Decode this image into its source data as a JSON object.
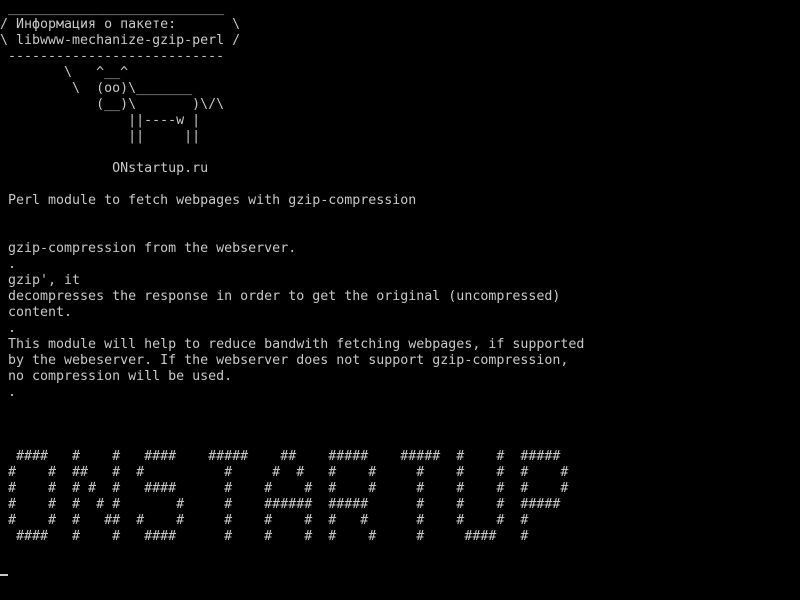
{
  "colors": {
    "background": "#000000",
    "foreground": "#c8c8c8"
  },
  "terminal": {
    "lines": [
      " ___________________________",
      "/ Информация о пакете:       \\",
      "\\ libwww-mechanize-gzip-perl /",
      " ---------------------------",
      "        \\   ^__^",
      "         \\  (oo)\\_______",
      "            (__)\\       )\\/\\",
      "                ||----w |",
      "                ||     ||",
      "",
      "              ONstartup.ru",
      "",
      " Perl module to fetch webpages with gzip-compression",
      "",
      "",
      " gzip-compression from the webserver.",
      " .",
      " gzip', it",
      " decompresses the response in order to get the original (uncompressed)",
      " content.",
      " .",
      " This module will help to reduce bandwith fetching webpages, if supported",
      " by the webeserver. If the webserver does not support gzip-compression,",
      " no compression will be used.",
      " .",
      "",
      "",
      "",
      "  ####   #    #   ####    #####    ##    #####    #####  #    #  #####",
      " #    #  ##   #  #          #     #  #   #    #     #    #    #  #    #",
      " #    #  # #  #   ####      #    #    #  #    #     #    #    #  #    #",
      " #    #  #  # #       #     #    ######  #####      #    #    #  #####",
      " #    #  #   ##  #    #     #    #    #  #   #      #    #    #  #",
      "  ####   #    #   ####      #    #    #  #    #     #     ####   #"
    ]
  }
}
